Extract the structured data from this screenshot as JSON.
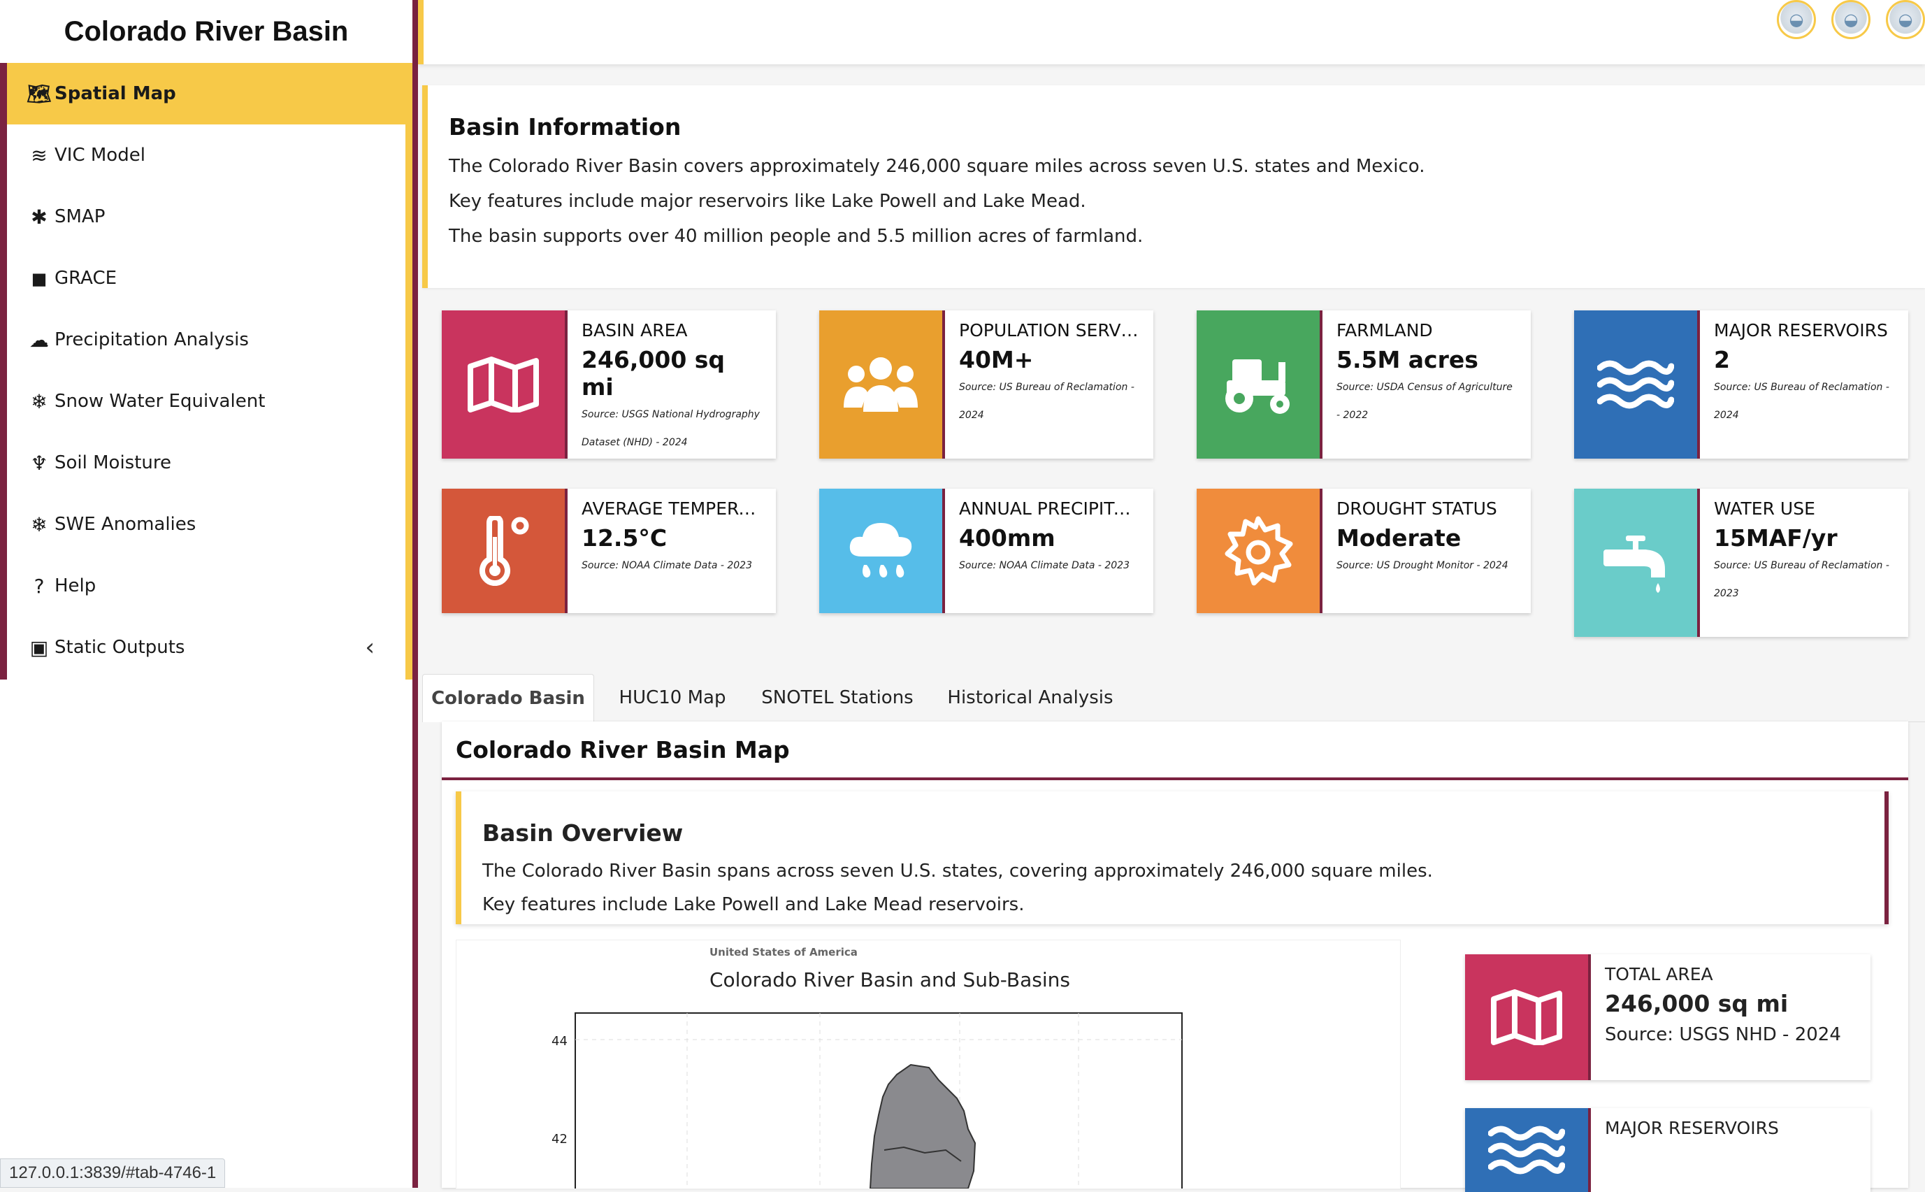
{
  "app": {
    "title": "Colorado River Basin"
  },
  "colors": {
    "maroon": "#7b2240",
    "yellow": "#f7c948"
  },
  "sidebar": {
    "items": [
      {
        "label": "Spatial Map",
        "icon": "map-icon",
        "glyph": "🗺",
        "active": true
      },
      {
        "label": "VIC Model",
        "icon": "water-icon",
        "glyph": "≋"
      },
      {
        "label": "SMAP",
        "icon": "satellite-icon",
        "glyph": "✱"
      },
      {
        "label": "GRACE",
        "icon": "weight-icon",
        "glyph": "◼"
      },
      {
        "label": "Precipitation Analysis",
        "icon": "cloud-rain-icon",
        "glyph": "☁"
      },
      {
        "label": "Snow Water Equivalent",
        "icon": "snowflake-icon",
        "glyph": "❄"
      },
      {
        "label": "Soil Moisture",
        "icon": "seedling-icon",
        "glyph": "♆"
      },
      {
        "label": "SWE Anomalies",
        "icon": "snowflake-icon",
        "glyph": "❄"
      },
      {
        "label": "Help",
        "icon": "question-circle-icon",
        "glyph": "?"
      },
      {
        "label": "Static Outputs",
        "icon": "image-icon",
        "glyph": "▣",
        "chevron": "‹"
      }
    ]
  },
  "basin_info": {
    "title": "Basin Information",
    "lines": [
      "The Colorado River Basin covers approximately 246,000 square miles across seven U.S. states and Mexico.",
      "Key features include major reservoirs like Lake Powell and Lake Mead.",
      "The basin supports over 40 million people and 5.5 million acres of farmland."
    ]
  },
  "stats": [
    {
      "label": "BASIN AREA",
      "value": "246,000 sq mi",
      "source": "Source: USGS National Hydrography Dataset (NHD) - 2024",
      "color": "#c9345e",
      "icon": "map-icon"
    },
    {
      "label": "POPULATION SERVED",
      "value": "40M+",
      "source": "Source: US Bureau of Reclamation - 2024",
      "color": "#e99f2e",
      "icon": "users-icon"
    },
    {
      "label": "FARMLAND",
      "value": "5.5M acres",
      "source": "Source: USDA Census of Agriculture - 2022",
      "color": "#48a75e",
      "icon": "tractor-icon"
    },
    {
      "label": "MAJOR RESERVOIRS",
      "value": "2",
      "source": "Source: US Bureau of Reclamation - 2024",
      "color": "#2f6fb6",
      "icon": "water-icon"
    },
    {
      "label": "AVERAGE TEMPERA...",
      "value": "12.5°C",
      "source": "Source: NOAA Climate Data - 2023",
      "color": "#d4573a",
      "icon": "thermometer-icon"
    },
    {
      "label": "ANNUAL PRECIPITA...",
      "value": "400mm",
      "source": "Source: NOAA Climate Data - 2023",
      "color": "#56bde9",
      "icon": "cloud-rain-icon"
    },
    {
      "label": "DROUGHT STATUS",
      "value": "Moderate",
      "source": "Source: US Drought Monitor - 2024",
      "color": "#f08c3c",
      "icon": "sun-icon"
    },
    {
      "label": "WATER USE",
      "value": "15MAF/yr",
      "source": "Source: US Bureau of Reclamation - 2023",
      "color": "#6accc9",
      "icon": "faucet-icon"
    }
  ],
  "tabs": [
    "Colorado Basin",
    "HUC10 Map",
    "SNOTEL Stations",
    "Historical Analysis"
  ],
  "panel": {
    "title": "Colorado River Basin Map",
    "overview_title": "Basin Overview",
    "overview_lines": [
      "The Colorado River Basin spans across seven U.S. states, covering approximately 246,000 square miles.",
      "Key features include Lake Powell and Lake Mead reservoirs."
    ]
  },
  "map": {
    "caption": "United States of America",
    "title": "Colorado River Basin and Sub-Basins",
    "yticks": [
      "44",
      "42"
    ]
  },
  "side_cards": [
    {
      "label": "TOTAL AREA",
      "value": "246,000 sq mi",
      "source": "Source: USGS NHD - 2024",
      "color": "#c9345e",
      "icon": "map-icon"
    },
    {
      "label": "MAJOR RESERVOIRS",
      "color": "#2f6fb6",
      "icon": "water-icon"
    }
  ],
  "statusbar": {
    "url": "127.0.0.1:3839/#tab-4746-1"
  }
}
